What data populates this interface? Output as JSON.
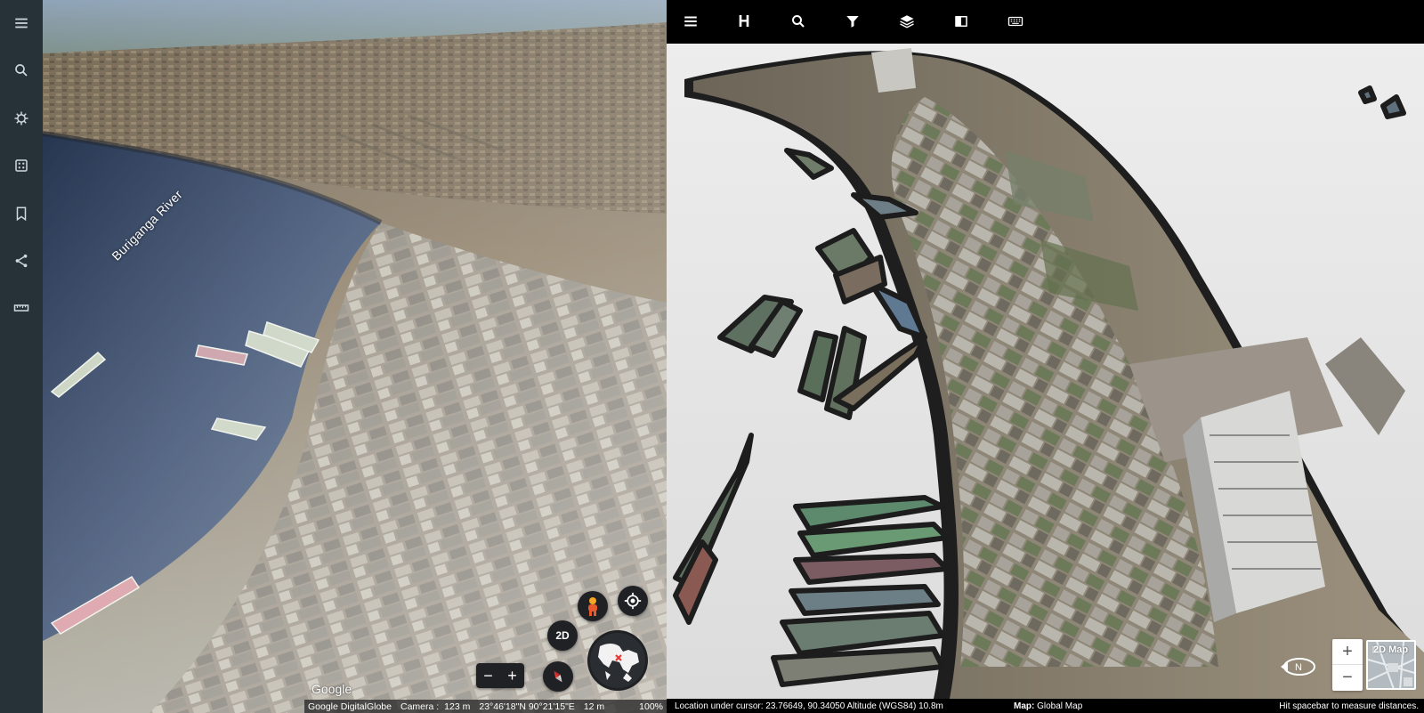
{
  "earth": {
    "river_label": "Buriganga River",
    "view_2d_label": "2D",
    "zoom_out_label": "−",
    "zoom_in_label": "+",
    "logo_text": "Google",
    "status": {
      "attribution": "Google DigitalGlobe",
      "camera_label": "Camera :",
      "camera_value": "123 m",
      "coordinates": "23°46'18\"N 90°21'15\"E",
      "elevation": "12 m",
      "load_percent": "100%"
    },
    "icons": [
      "menu-icon",
      "search-icon",
      "voyager-icon",
      "feeling-lucky-icon",
      "bookmark-icon",
      "share-icon",
      "ruler-icon"
    ]
  },
  "viewer": {
    "toolbar_h_label": "H",
    "icons": [
      "menu-icon",
      "search-icon",
      "filter-icon",
      "layers-icon",
      "split-view-icon",
      "keyboard-icon"
    ],
    "zoom_in_label": "+",
    "zoom_out_label": "−",
    "map2d_label": "2D Map",
    "status": {
      "location": "Location under cursor:  23.76649, 90.34050  Altitude (WGS84) 10.8m",
      "map_label": "Map:",
      "map_value": "Global Map",
      "hint": "Hit spacebar to measure distances."
    }
  }
}
